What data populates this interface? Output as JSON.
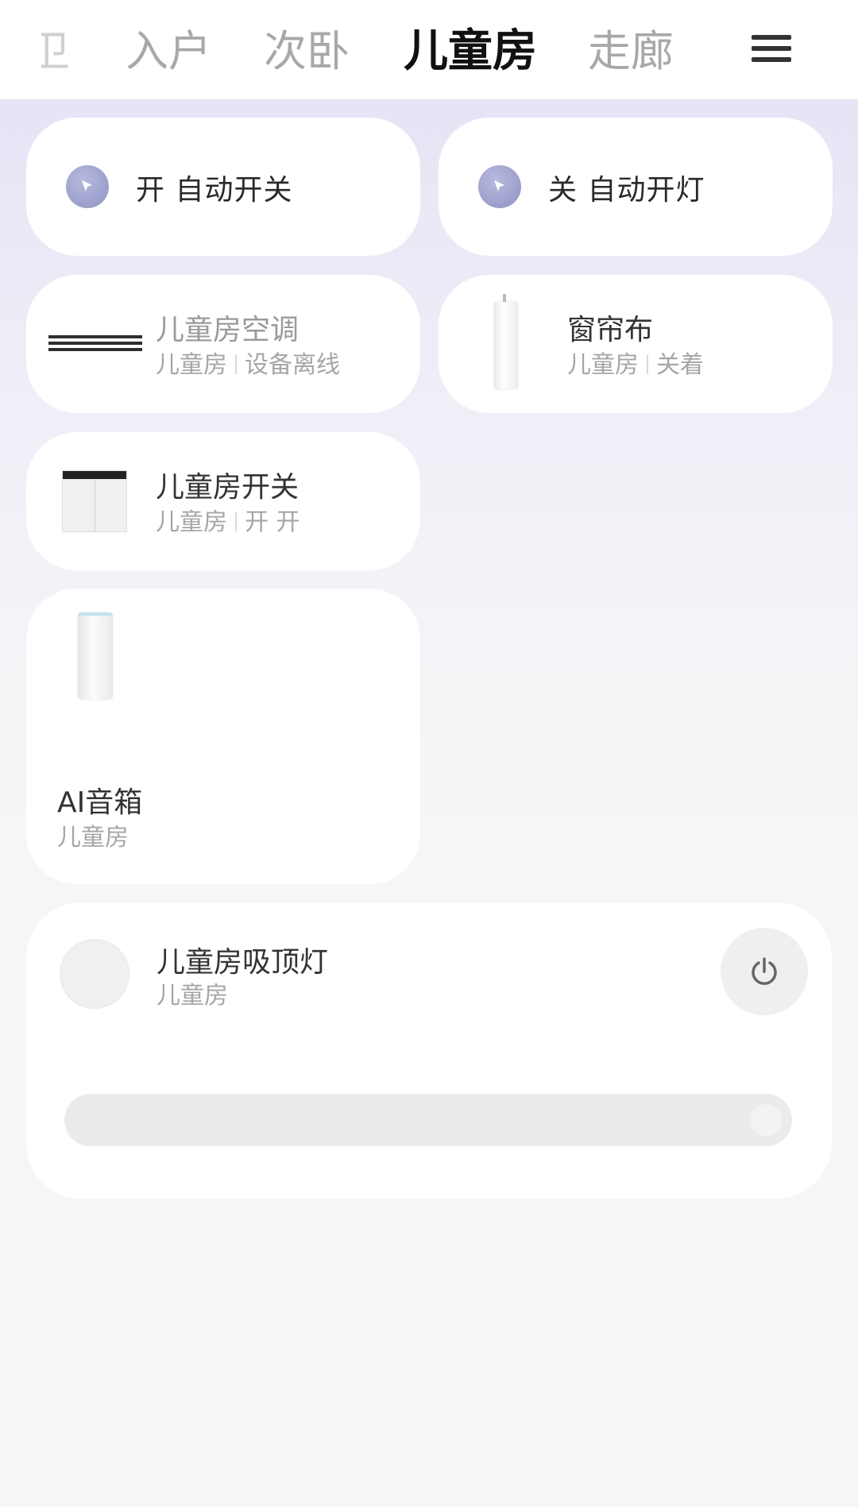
{
  "tabs": {
    "partial": "卫",
    "items": [
      "入户",
      "次卧",
      "儿童房",
      "走廊"
    ],
    "active_index": 2
  },
  "scenes": [
    {
      "label": "开 自动开关"
    },
    {
      "label": "关 自动开灯"
    }
  ],
  "devices": {
    "ac": {
      "name": "儿童房空调",
      "room": "儿童房",
      "status": "设备离线"
    },
    "curtain": {
      "name": "窗帘布",
      "room": "儿童房",
      "status": "关着"
    },
    "switch": {
      "name": "儿童房开关",
      "room": "儿童房",
      "status": "开 开"
    },
    "speaker": {
      "name": "AI音箱",
      "room": "儿童房"
    }
  },
  "lamp": {
    "name": "儿童房吸顶灯",
    "room": "儿童房",
    "brightness": 1.0
  },
  "colors": {
    "scene_icon": "#9a9ecb",
    "active_tab": "#111111",
    "inactive_tab": "#a8a8a8"
  },
  "icons": {
    "menu": "hamburger-icon",
    "scene": "cursor-arrow-icon",
    "power": "power-icon"
  }
}
